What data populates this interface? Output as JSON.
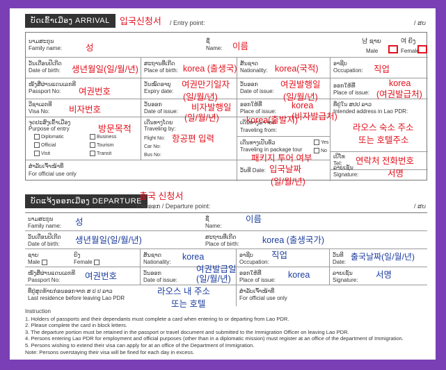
{
  "arrival": {
    "header": "ບັດເຂົ້າເມືອງ ARRIVAL",
    "title_annotation": "입국신청서",
    "entry_point_label": "/ Entry point:",
    "form_number": "/ ສບ",
    "family_name_label_lo": "ນາມສະກຸນ",
    "family_name_label": "Family name:",
    "family_name": "성",
    "name_label_lo": "ຊື່",
    "name_label": "Name:",
    "name": "이름",
    "male_lo": "남 ຊາຍ",
    "female_lo": "여 ຍິງ",
    "male_label": "Male",
    "female_label": "Female",
    "dob_label_lo": "ວັນເດືອນປີເກີດ",
    "dob_label": "Date of birth:",
    "dob": "생년월일(일/월/년)",
    "pob_label_lo": "ສະຖານທີ່ເກີດ",
    "pob_label": "Place of birth:",
    "pob": "korea (출생국)",
    "nationality_label_lo": "ສັນຊາດ",
    "nationality_label": "Nationality:",
    "nationality": "korea(국적)",
    "occupation_label_lo": "ອາຊີບ",
    "occupation_label": "Occupation:",
    "occupation": "직업",
    "passport_label_lo": "ໜັງສືຜ່ານແດນເລກທີ",
    "passport_label": "Passport No:",
    "passport_no": "여권번호",
    "expiry_label_lo": "ວັນໝົດອາຍຸ",
    "expiry_label": "Expiry date:",
    "expiry": "여권만기일자",
    "expiry_format": "(일/월/년)",
    "date_of_issue_label_lo": "ວັນອອກ",
    "date_of_issue_label": "Date of issue:",
    "passport_issue": "여권발행일",
    "passport_issue_format": "(일/월/년)",
    "place_issue_label_lo": "ອອກໃຫ້ທີ່",
    "place_issue_label": "Place of issue:",
    "passport_place": "korea",
    "passport_place_note": "(여권발급처)",
    "visa_label_lo": "ວີຊາເລກທີ",
    "visa_label": "Visa No:",
    "visa_no": "비자번호",
    "visa_issue": "비자발행일",
    "visa_issue_format": "(일/월/년)",
    "visa_place": "korea",
    "visa_place_note": "(비자발급처)",
    "address_label_lo": "ທີ່ຢູ່ໃນ ສປປ ລາວ",
    "address_label": "Intended address in Lao PDR:",
    "address": "라오스 숙소 주소",
    "address_note": "또는 호텔주소",
    "purpose_label_lo": "ຈຸດປະສົງເຂົ້າເມືອງ",
    "purpose_label": "Purpose of entry",
    "purpose_options": [
      "Diplomatic",
      "Official",
      "Visit",
      "Business",
      "Tourism",
      "Transit"
    ],
    "purpose": "방문목적",
    "traveling_by_label_lo": "ເດີນທາງໂດຍ",
    "traveling_by_label": "Traveling by:",
    "flight_label": "Flight No:",
    "car_label": "Car No:",
    "bus_label": "Bus No:",
    "traveling_by": "항공편 입력",
    "traveling_from_label_lo": "ເດີນທາງມາຈາກ",
    "traveling_from_label": "Traveling from:",
    "traveling_from": "korea(출발지)",
    "package_label_lo": "ເດີນທາງເປັນທົວ",
    "package_label": "Traveling in package tour",
    "yes_label": "Yes",
    "no_label": "No",
    "package_tour": "패키지 투어 여부",
    "tel_label_lo": "ເບີໂທ",
    "tel_label": "Tel:",
    "tel": "연락처 전화번호",
    "official_label_lo": "ສຳລັບເຈົ້າໜ້າທີ່",
    "official_label": "For official use only",
    "date_label": "ວັນທີ Date:",
    "arrival_date": "입국날짜",
    "arrival_date_format": "(일/월/년)",
    "signature_label_lo": "ລາຍເຊັນ",
    "signature_label": "Signature:",
    "signature": "서명"
  },
  "departure": {
    "header": "ບັດແຈ້ງອອກເມືອງ DEPARTURE",
    "title_annotation": "출국 신청서",
    "departure_point_label": "ດ່ານອອກ / Departure point:",
    "form_number": "/ ສບ",
    "family_name_label_lo": "ນາມສະກຸນ",
    "family_name_label": "Family name:",
    "family_name": "성",
    "name_label_lo": "ຊື່",
    "name_label": "Name:",
    "name": "이름",
    "dob_label_lo": "ວັນເດືອນປີເກີດ",
    "dob_label": "Date of birth:",
    "dob": "생년월일(일/월/년)",
    "pob_label_lo": "ສະຖານທີ່ເກີດ",
    "pob_label": "Place of birth:",
    "pob": "korea (출생국가)",
    "male_lo": "ຊາຍ",
    "female_lo": "ຍິງ",
    "male_label": "Male",
    "female_label": "Female",
    "nationality_label_lo": "ສັນຊາດ",
    "nationality_label": "Nationality:",
    "nationality": "korea",
    "occupation_label_lo": "ອາຊີບ",
    "occupation_label": "Occupation:",
    "occupation": "직업",
    "date_label_lo": "ວັນທີ",
    "date_label": "Date:",
    "departure_date": "출국날짜(일/월/년)",
    "passport_label_lo": "ໜັງສືຜ່ານແດນເລກທີ",
    "passport_label": "Passport No:",
    "passport_no": "여권번호",
    "date_of_issue_label_lo": "ວັນອອກ",
    "date_of_issue_label": "Date of issue:",
    "issue_date": "여권발급일",
    "issue_date_format": "(일/월/년)",
    "place_issue_label_lo": "ອອກໃຫ້ທີ່",
    "place_issue_label": "Place of issue:",
    "place_of_issue": "korea",
    "signature_label_lo": "ລາຍເຊັນ",
    "signature_label": "Signature:",
    "signature": "서명",
    "residence_label_lo": "ທີ່ຢູ່ສຸດທ້າຍກ່ອນອອກຈາກ ສ ປ ປ ລາວ",
    "residence_label": "Last residence before leaving Lao PDR",
    "residence": "라오스 내 주소",
    "residence_note": "또는 호텔",
    "official_label_lo": "ສຳລັບເຈົ້າໜ້າທີ່",
    "official_label": "For official use only"
  },
  "instructions": {
    "title": "Instruction",
    "lines": [
      "1. Holders of passports and their dependants must complete a card when entering to or departing from Lao PDR.",
      "2. Please complete the card in block letters.",
      "3. The departure portion must be retained in the passport or travel document and submitted to the Immigration Officer on leaving Lao PDR.",
      "4. Persons entering Lao PDR for employment and official purposes (other than in a diplomatic mission) must register at an office of the department of Immigration.",
      "5. Persons wishing to extend their visa can apply for at an office of the Department of Immigration.",
      "Note: Persons overstaying their visa will be fined for each day in excess."
    ]
  },
  "colors": {
    "frame": "#7a3fb5",
    "annotation_red": "#e3101c",
    "annotation_blue": "#1b3c9e",
    "header_bg": "#333333"
  }
}
